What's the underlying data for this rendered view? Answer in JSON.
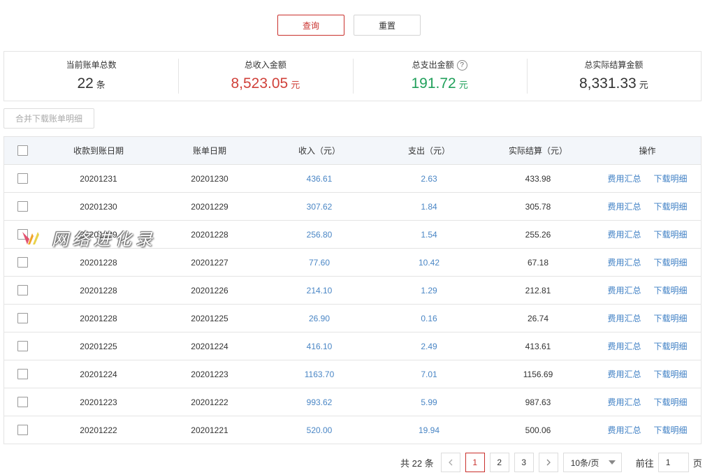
{
  "actions": {
    "query_label": "查询",
    "reset_label": "重置"
  },
  "summary": [
    {
      "label": "当前账单总数",
      "value": "22",
      "unit": "条",
      "color": "#333333"
    },
    {
      "label": "总收入金额",
      "value": "8,523.05",
      "unit": "元",
      "color": "#d0413a"
    },
    {
      "label": "总支出金额",
      "value": "191.72",
      "unit": "元",
      "color": "#21a05b",
      "help_icon": "question-circle-icon"
    },
    {
      "label": "总实际结算金额",
      "value": "8,331.33",
      "unit": "元",
      "color": "#333333"
    }
  ],
  "merge_download_label": "合并下载账单明细",
  "table": {
    "headers": [
      "收款到账日期",
      "账单日期",
      "收入（元）",
      "支出（元）",
      "实际结算（元）",
      "操作"
    ],
    "rows": [
      {
        "arrival": "20201231",
        "bill": "20201230",
        "income": "436.61",
        "expense": "2.63",
        "settle": "433.98"
      },
      {
        "arrival": "20201230",
        "bill": "20201229",
        "income": "307.62",
        "expense": "1.84",
        "settle": "305.78"
      },
      {
        "arrival": "20201229",
        "bill": "20201228",
        "income": "256.80",
        "expense": "1.54",
        "settle": "255.26"
      },
      {
        "arrival": "20201228",
        "bill": "20201227",
        "income": "77.60",
        "expense": "10.42",
        "settle": "67.18"
      },
      {
        "arrival": "20201228",
        "bill": "20201226",
        "income": "214.10",
        "expense": "1.29",
        "settle": "212.81"
      },
      {
        "arrival": "20201228",
        "bill": "20201225",
        "income": "26.90",
        "expense": "0.16",
        "settle": "26.74"
      },
      {
        "arrival": "20201225",
        "bill": "20201224",
        "income": "416.10",
        "expense": "2.49",
        "settle": "413.61"
      },
      {
        "arrival": "20201224",
        "bill": "20201223",
        "income": "1163.70",
        "expense": "7.01",
        "settle": "1156.69"
      },
      {
        "arrival": "20201223",
        "bill": "20201222",
        "income": "993.62",
        "expense": "5.99",
        "settle": "987.63"
      },
      {
        "arrival": "20201222",
        "bill": "20201221",
        "income": "520.00",
        "expense": "19.94",
        "settle": "500.06"
      }
    ],
    "op_fee_label": "费用汇总",
    "op_download_label": "下载明细"
  },
  "pagination": {
    "total_text": "共 22 条",
    "pages": [
      "1",
      "2",
      "3"
    ],
    "current": "1",
    "page_size": "10条/页",
    "goto_label": "前往",
    "goto_value": "1",
    "page_unit": "页"
  },
  "watermark_text": "网络进化录",
  "colors": {
    "accent": "#c9302c",
    "link": "#3e7fc4",
    "income_text": "#4a86c5"
  }
}
